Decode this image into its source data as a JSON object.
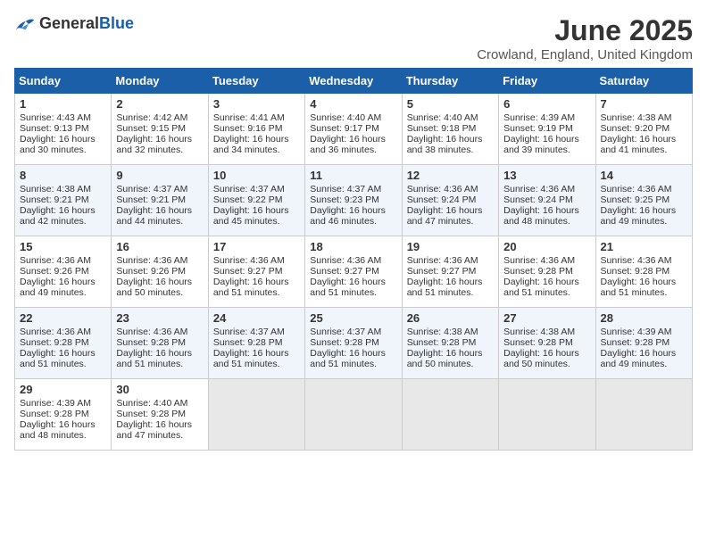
{
  "header": {
    "logo_general": "General",
    "logo_blue": "Blue",
    "month_title": "June 2025",
    "location": "Crowland, England, United Kingdom"
  },
  "days_of_week": [
    "Sunday",
    "Monday",
    "Tuesday",
    "Wednesday",
    "Thursday",
    "Friday",
    "Saturday"
  ],
  "weeks": [
    [
      {
        "day": "1",
        "sunrise": "Sunrise: 4:43 AM",
        "sunset": "Sunset: 9:13 PM",
        "daylight": "Daylight: 16 hours and 30 minutes."
      },
      {
        "day": "2",
        "sunrise": "Sunrise: 4:42 AM",
        "sunset": "Sunset: 9:15 PM",
        "daylight": "Daylight: 16 hours and 32 minutes."
      },
      {
        "day": "3",
        "sunrise": "Sunrise: 4:41 AM",
        "sunset": "Sunset: 9:16 PM",
        "daylight": "Daylight: 16 hours and 34 minutes."
      },
      {
        "day": "4",
        "sunrise": "Sunrise: 4:40 AM",
        "sunset": "Sunset: 9:17 PM",
        "daylight": "Daylight: 16 hours and 36 minutes."
      },
      {
        "day": "5",
        "sunrise": "Sunrise: 4:40 AM",
        "sunset": "Sunset: 9:18 PM",
        "daylight": "Daylight: 16 hours and 38 minutes."
      },
      {
        "day": "6",
        "sunrise": "Sunrise: 4:39 AM",
        "sunset": "Sunset: 9:19 PM",
        "daylight": "Daylight: 16 hours and 39 minutes."
      },
      {
        "day": "7",
        "sunrise": "Sunrise: 4:38 AM",
        "sunset": "Sunset: 9:20 PM",
        "daylight": "Daylight: 16 hours and 41 minutes."
      }
    ],
    [
      {
        "day": "8",
        "sunrise": "Sunrise: 4:38 AM",
        "sunset": "Sunset: 9:21 PM",
        "daylight": "Daylight: 16 hours and 42 minutes."
      },
      {
        "day": "9",
        "sunrise": "Sunrise: 4:37 AM",
        "sunset": "Sunset: 9:21 PM",
        "daylight": "Daylight: 16 hours and 44 minutes."
      },
      {
        "day": "10",
        "sunrise": "Sunrise: 4:37 AM",
        "sunset": "Sunset: 9:22 PM",
        "daylight": "Daylight: 16 hours and 45 minutes."
      },
      {
        "day": "11",
        "sunrise": "Sunrise: 4:37 AM",
        "sunset": "Sunset: 9:23 PM",
        "daylight": "Daylight: 16 hours and 46 minutes."
      },
      {
        "day": "12",
        "sunrise": "Sunrise: 4:36 AM",
        "sunset": "Sunset: 9:24 PM",
        "daylight": "Daylight: 16 hours and 47 minutes."
      },
      {
        "day": "13",
        "sunrise": "Sunrise: 4:36 AM",
        "sunset": "Sunset: 9:24 PM",
        "daylight": "Daylight: 16 hours and 48 minutes."
      },
      {
        "day": "14",
        "sunrise": "Sunrise: 4:36 AM",
        "sunset": "Sunset: 9:25 PM",
        "daylight": "Daylight: 16 hours and 49 minutes."
      }
    ],
    [
      {
        "day": "15",
        "sunrise": "Sunrise: 4:36 AM",
        "sunset": "Sunset: 9:26 PM",
        "daylight": "Daylight: 16 hours and 49 minutes."
      },
      {
        "day": "16",
        "sunrise": "Sunrise: 4:36 AM",
        "sunset": "Sunset: 9:26 PM",
        "daylight": "Daylight: 16 hours and 50 minutes."
      },
      {
        "day": "17",
        "sunrise": "Sunrise: 4:36 AM",
        "sunset": "Sunset: 9:27 PM",
        "daylight": "Daylight: 16 hours and 51 minutes."
      },
      {
        "day": "18",
        "sunrise": "Sunrise: 4:36 AM",
        "sunset": "Sunset: 9:27 PM",
        "daylight": "Daylight: 16 hours and 51 minutes."
      },
      {
        "day": "19",
        "sunrise": "Sunrise: 4:36 AM",
        "sunset": "Sunset: 9:27 PM",
        "daylight": "Daylight: 16 hours and 51 minutes."
      },
      {
        "day": "20",
        "sunrise": "Sunrise: 4:36 AM",
        "sunset": "Sunset: 9:28 PM",
        "daylight": "Daylight: 16 hours and 51 minutes."
      },
      {
        "day": "21",
        "sunrise": "Sunrise: 4:36 AM",
        "sunset": "Sunset: 9:28 PM",
        "daylight": "Daylight: 16 hours and 51 minutes."
      }
    ],
    [
      {
        "day": "22",
        "sunrise": "Sunrise: 4:36 AM",
        "sunset": "Sunset: 9:28 PM",
        "daylight": "Daylight: 16 hours and 51 minutes."
      },
      {
        "day": "23",
        "sunrise": "Sunrise: 4:36 AM",
        "sunset": "Sunset: 9:28 PM",
        "daylight": "Daylight: 16 hours and 51 minutes."
      },
      {
        "day": "24",
        "sunrise": "Sunrise: 4:37 AM",
        "sunset": "Sunset: 9:28 PM",
        "daylight": "Daylight: 16 hours and 51 minutes."
      },
      {
        "day": "25",
        "sunrise": "Sunrise: 4:37 AM",
        "sunset": "Sunset: 9:28 PM",
        "daylight": "Daylight: 16 hours and 51 minutes."
      },
      {
        "day": "26",
        "sunrise": "Sunrise: 4:38 AM",
        "sunset": "Sunset: 9:28 PM",
        "daylight": "Daylight: 16 hours and 50 minutes."
      },
      {
        "day": "27",
        "sunrise": "Sunrise: 4:38 AM",
        "sunset": "Sunset: 9:28 PM",
        "daylight": "Daylight: 16 hours and 50 minutes."
      },
      {
        "day": "28",
        "sunrise": "Sunrise: 4:39 AM",
        "sunset": "Sunset: 9:28 PM",
        "daylight": "Daylight: 16 hours and 49 minutes."
      }
    ],
    [
      {
        "day": "29",
        "sunrise": "Sunrise: 4:39 AM",
        "sunset": "Sunset: 9:28 PM",
        "daylight": "Daylight: 16 hours and 48 minutes."
      },
      {
        "day": "30",
        "sunrise": "Sunrise: 4:40 AM",
        "sunset": "Sunset: 9:28 PM",
        "daylight": "Daylight: 16 hours and 47 minutes."
      },
      null,
      null,
      null,
      null,
      null
    ]
  ]
}
